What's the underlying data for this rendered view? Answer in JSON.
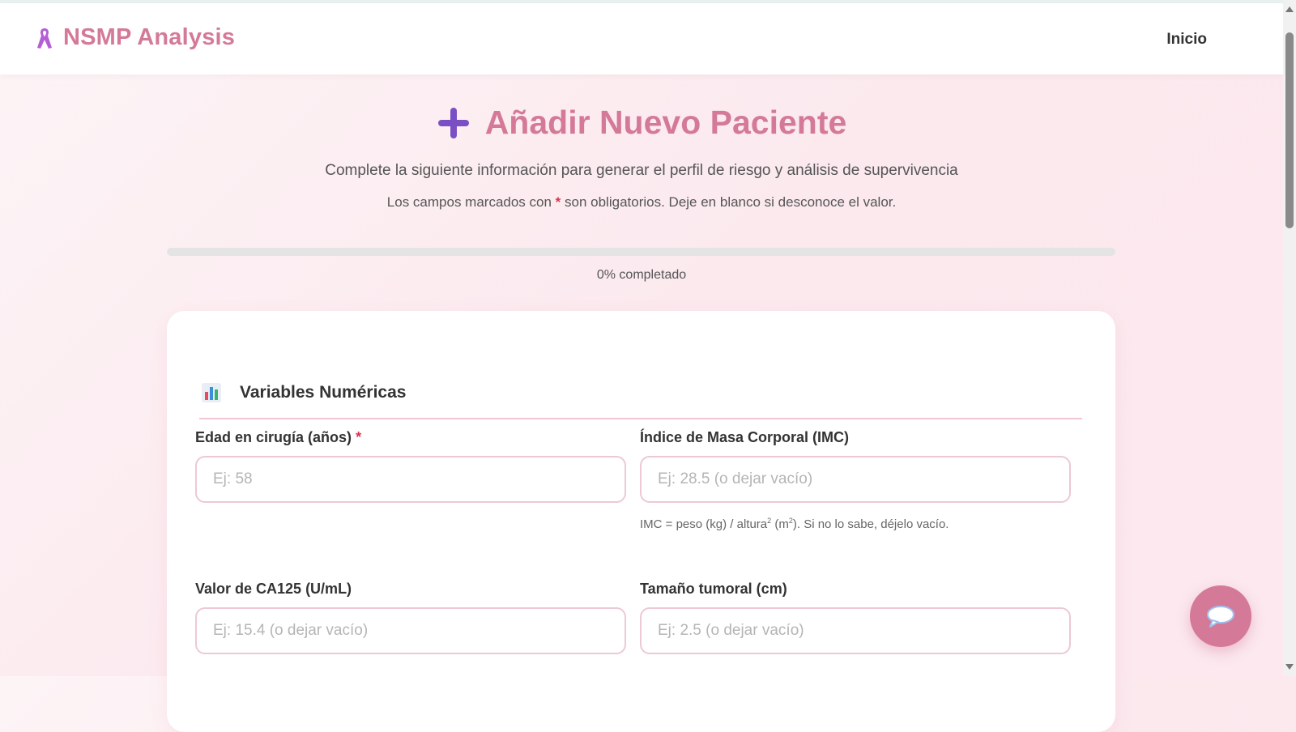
{
  "navbar": {
    "brand_icon": "ribbon-icon",
    "brand_name": "NSMP Analysis",
    "link_home": "Inicio"
  },
  "header": {
    "title_icon": "plus-icon",
    "title": "Añadir Nuevo Paciente",
    "subtitle": "Complete la siguiente información para generar el perfil de riesgo y análisis de supervivencia",
    "note_before": "Los campos marcados con ",
    "note_asterisk": "*",
    "note_after": " son obligatorios. Deje en blanco si desconoce el valor."
  },
  "progress": {
    "percent": 0,
    "label": "0% completado"
  },
  "section": {
    "icon": "bar-chart-icon",
    "title": "Variables Numéricas"
  },
  "fields": {
    "age": {
      "label": "Edad en cirugía (años)",
      "required_mark": "*",
      "placeholder": "Ej: 58",
      "value": ""
    },
    "bmi": {
      "label": "Índice de Masa Corporal (IMC)",
      "placeholder": "Ej: 28.5 (o dejar vacío)",
      "value": "",
      "help_a": "IMC = peso (kg) / altura",
      "help_sup1": "2",
      "help_b": " (m",
      "help_sup2": "2",
      "help_c": "). Si no lo sabe, déjelo vacío."
    },
    "ca125": {
      "label": "Valor de CA125 (U/mL)",
      "placeholder": "Ej: 15.4 (o dejar vacío)",
      "value": ""
    },
    "tumor_size": {
      "label": "Tamaño tumoral (cm)",
      "placeholder": "Ej: 2.5 (o dejar vacío)",
      "value": ""
    }
  },
  "chat": {
    "icon": "chat-bubble-icon"
  },
  "colors": {
    "brand": "#d47a98",
    "accent_purple": "#7b4fc4",
    "required": "#d9334f"
  }
}
